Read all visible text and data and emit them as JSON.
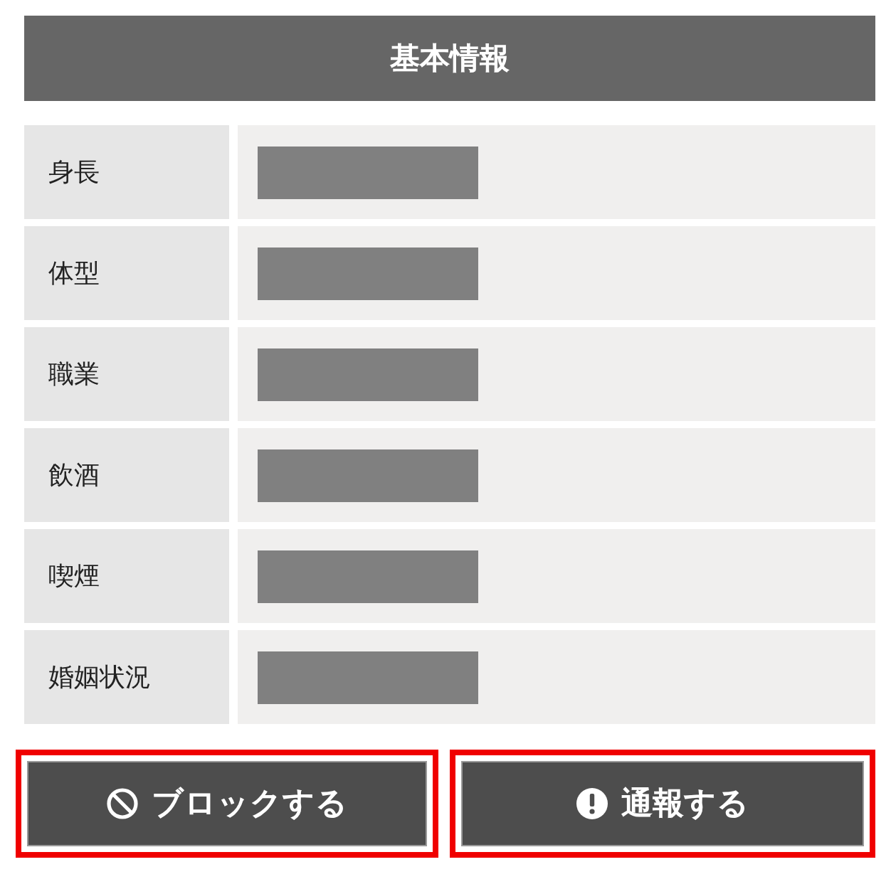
{
  "header": {
    "title": "基本情報"
  },
  "rows": [
    {
      "label": "身長"
    },
    {
      "label": "体型"
    },
    {
      "label": "職業"
    },
    {
      "label": "飲酒"
    },
    {
      "label": "喫煙"
    },
    {
      "label": "婚姻状況"
    }
  ],
  "buttons": [
    {
      "kind": "block",
      "label": "ブロックする",
      "highlighted": true
    },
    {
      "kind": "report",
      "label": "通報する",
      "highlighted": true
    }
  ]
}
